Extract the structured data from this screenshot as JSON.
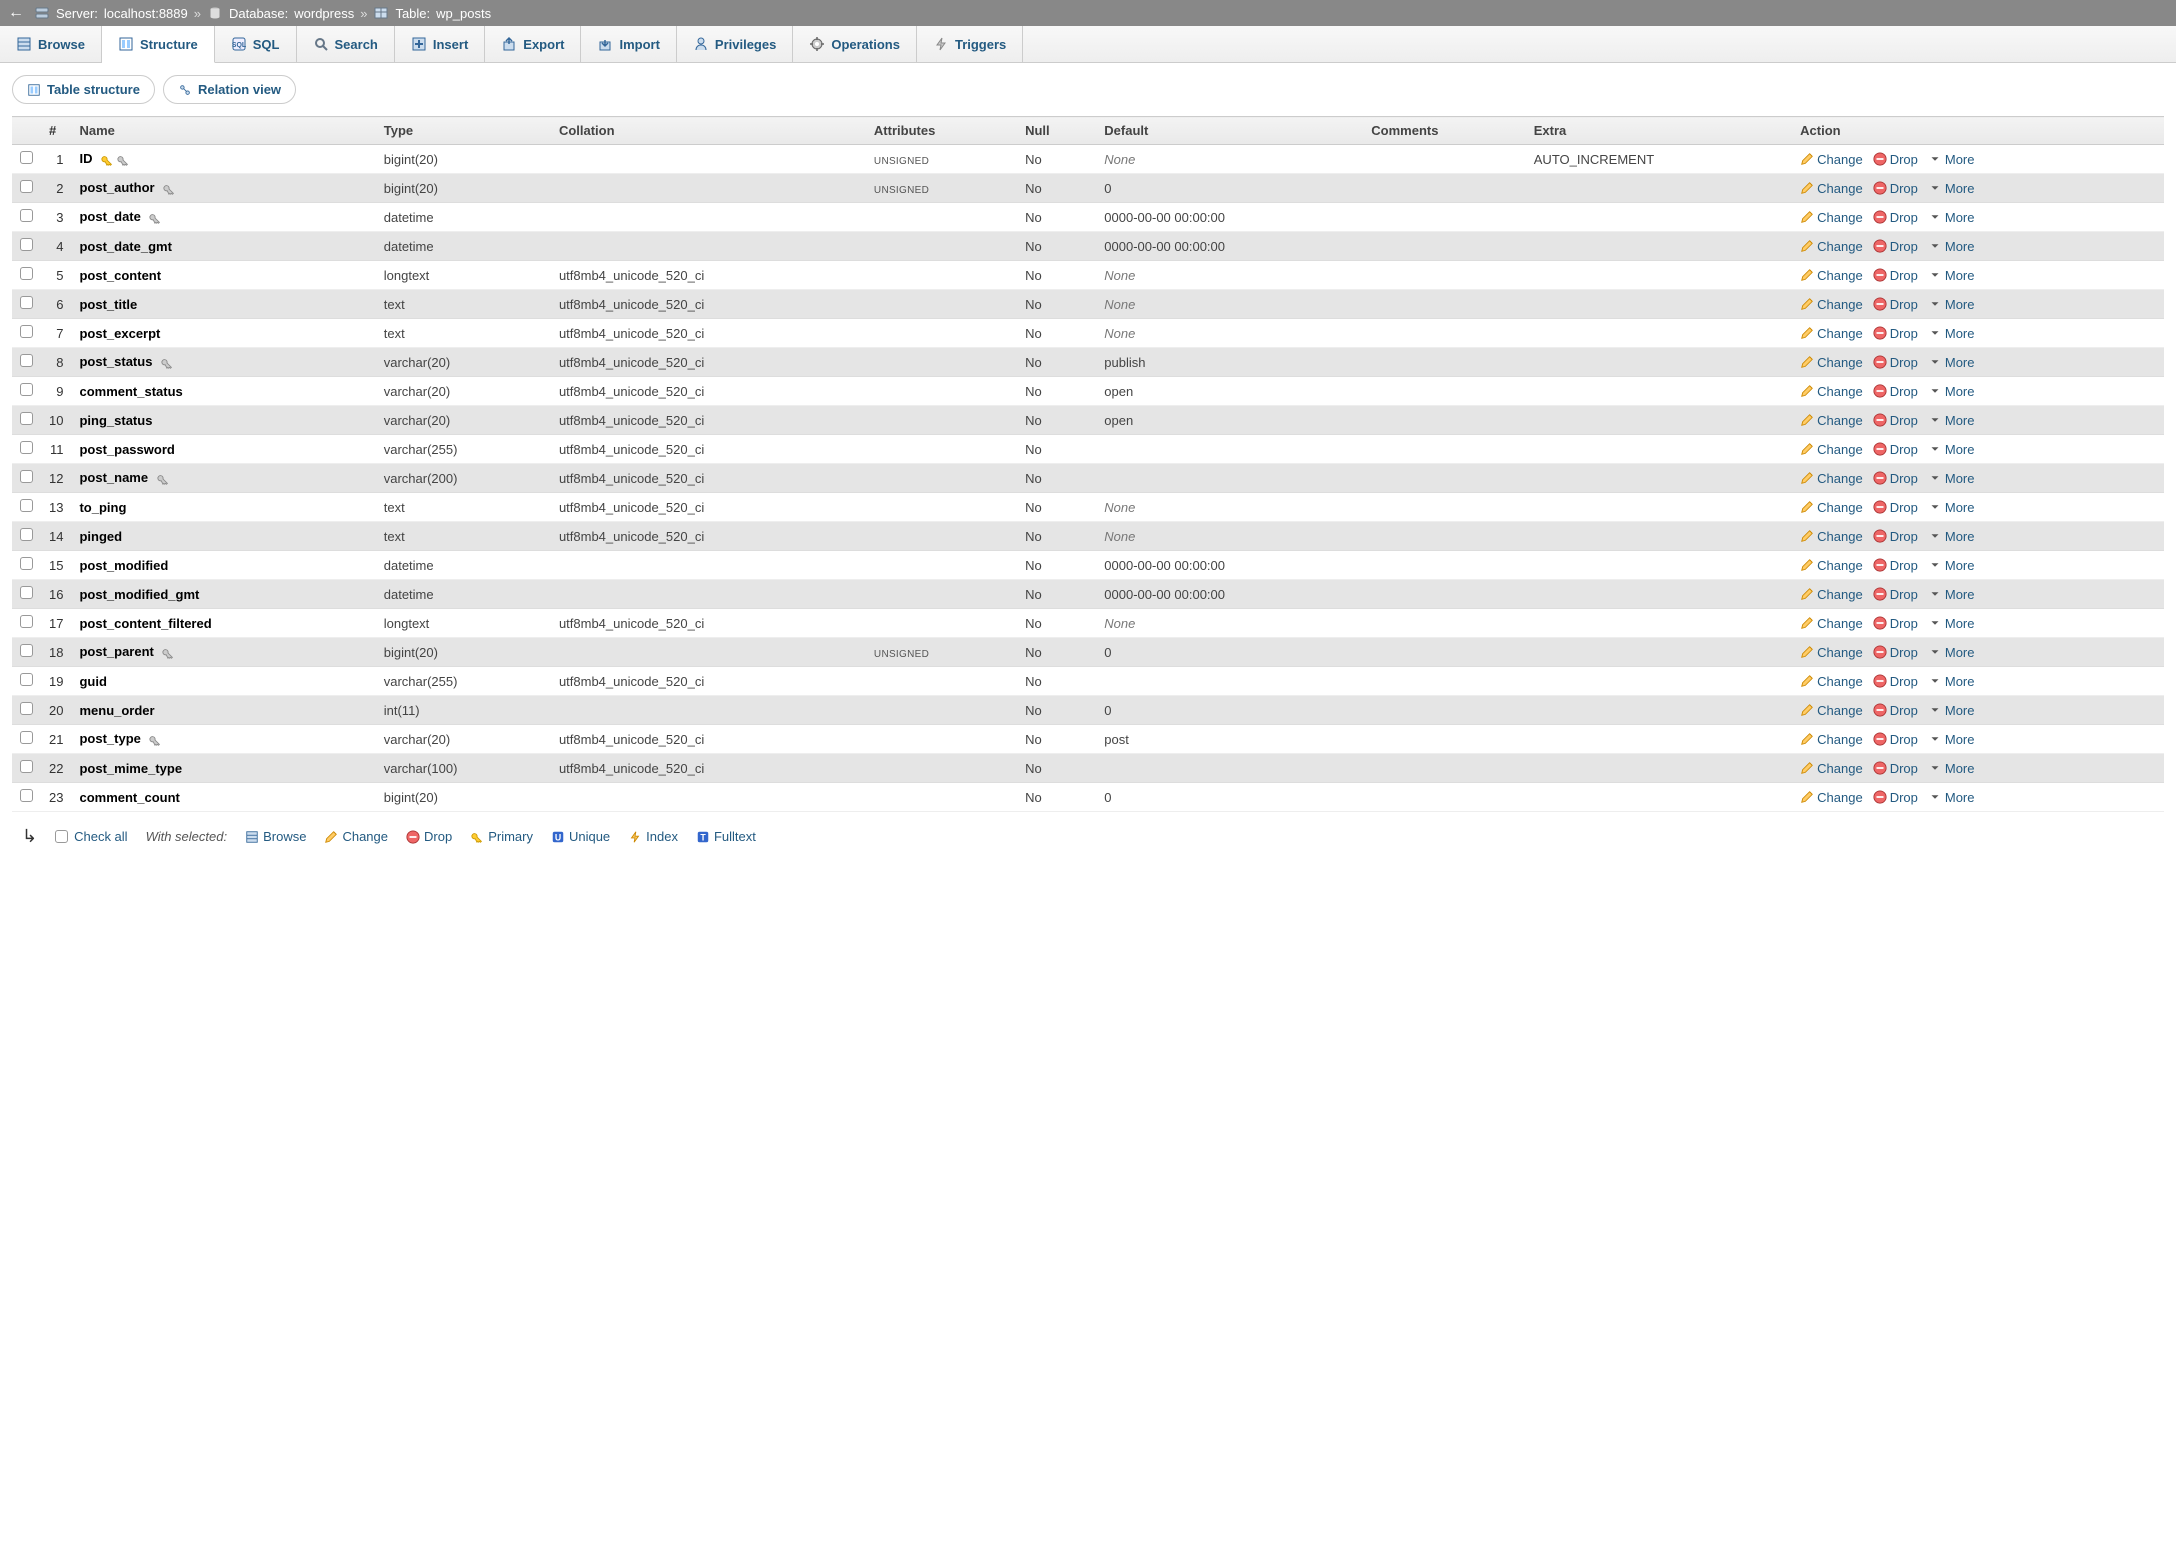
{
  "breadcrumb": {
    "server_label": "Server:",
    "server": "localhost:8889",
    "database_label": "Database:",
    "database": "wordpress",
    "table_label": "Table:",
    "table": "wp_posts"
  },
  "top_tabs": [
    {
      "label": "Browse",
      "icon": "browse-icon"
    },
    {
      "label": "Structure",
      "icon": "structure-icon",
      "active": true
    },
    {
      "label": "SQL",
      "icon": "sql-icon"
    },
    {
      "label": "Search",
      "icon": "search-icon"
    },
    {
      "label": "Insert",
      "icon": "insert-icon"
    },
    {
      "label": "Export",
      "icon": "export-icon"
    },
    {
      "label": "Import",
      "icon": "import-icon"
    },
    {
      "label": "Privileges",
      "icon": "privileges-icon"
    },
    {
      "label": "Operations",
      "icon": "operations-icon"
    },
    {
      "label": "Triggers",
      "icon": "triggers-icon"
    }
  ],
  "sub_tabs": [
    {
      "label": "Table structure",
      "active": true
    },
    {
      "label": "Relation view"
    }
  ],
  "headers": {
    "num": "#",
    "name": "Name",
    "type": "Type",
    "collation": "Collation",
    "attributes": "Attributes",
    "null": "Null",
    "default": "Default",
    "comments": "Comments",
    "extra": "Extra",
    "action": "Action"
  },
  "action_labels": {
    "change": "Change",
    "drop": "Drop",
    "more": "More"
  },
  "columns": [
    {
      "n": "1",
      "name": "ID",
      "type": "bigint(20)",
      "collation": "",
      "attributes": "UNSIGNED",
      "null": "No",
      "default": "None",
      "default_italic": true,
      "comments": "",
      "extra": "AUTO_INCREMENT",
      "primary": true,
      "index": true
    },
    {
      "n": "2",
      "name": "post_author",
      "type": "bigint(20)",
      "collation": "",
      "attributes": "UNSIGNED",
      "null": "No",
      "default": "0",
      "default_italic": false,
      "comments": "",
      "extra": "",
      "primary": false,
      "index": true
    },
    {
      "n": "3",
      "name": "post_date",
      "type": "datetime",
      "collation": "",
      "attributes": "",
      "null": "No",
      "default": "0000-00-00 00:00:00",
      "default_italic": false,
      "comments": "",
      "extra": "",
      "primary": false,
      "index": true
    },
    {
      "n": "4",
      "name": "post_date_gmt",
      "type": "datetime",
      "collation": "",
      "attributes": "",
      "null": "No",
      "default": "0000-00-00 00:00:00",
      "default_italic": false,
      "comments": "",
      "extra": "",
      "primary": false,
      "index": false
    },
    {
      "n": "5",
      "name": "post_content",
      "type": "longtext",
      "collation": "utf8mb4_unicode_520_ci",
      "attributes": "",
      "null": "No",
      "default": "None",
      "default_italic": true,
      "comments": "",
      "extra": "",
      "primary": false,
      "index": false
    },
    {
      "n": "6",
      "name": "post_title",
      "type": "text",
      "collation": "utf8mb4_unicode_520_ci",
      "attributes": "",
      "null": "No",
      "default": "None",
      "default_italic": true,
      "comments": "",
      "extra": "",
      "primary": false,
      "index": false
    },
    {
      "n": "7",
      "name": "post_excerpt",
      "type": "text",
      "collation": "utf8mb4_unicode_520_ci",
      "attributes": "",
      "null": "No",
      "default": "None",
      "default_italic": true,
      "comments": "",
      "extra": "",
      "primary": false,
      "index": false
    },
    {
      "n": "8",
      "name": "post_status",
      "type": "varchar(20)",
      "collation": "utf8mb4_unicode_520_ci",
      "attributes": "",
      "null": "No",
      "default": "publish",
      "default_italic": false,
      "comments": "",
      "extra": "",
      "primary": false,
      "index": true
    },
    {
      "n": "9",
      "name": "comment_status",
      "type": "varchar(20)",
      "collation": "utf8mb4_unicode_520_ci",
      "attributes": "",
      "null": "No",
      "default": "open",
      "default_italic": false,
      "comments": "",
      "extra": "",
      "primary": false,
      "index": false
    },
    {
      "n": "10",
      "name": "ping_status",
      "type": "varchar(20)",
      "collation": "utf8mb4_unicode_520_ci",
      "attributes": "",
      "null": "No",
      "default": "open",
      "default_italic": false,
      "comments": "",
      "extra": "",
      "primary": false,
      "index": false
    },
    {
      "n": "11",
      "name": "post_password",
      "type": "varchar(255)",
      "collation": "utf8mb4_unicode_520_ci",
      "attributes": "",
      "null": "No",
      "default": "",
      "default_italic": false,
      "comments": "",
      "extra": "",
      "primary": false,
      "index": false
    },
    {
      "n": "12",
      "name": "post_name",
      "type": "varchar(200)",
      "collation": "utf8mb4_unicode_520_ci",
      "attributes": "",
      "null": "No",
      "default": "",
      "default_italic": false,
      "comments": "",
      "extra": "",
      "primary": false,
      "index": true
    },
    {
      "n": "13",
      "name": "to_ping",
      "type": "text",
      "collation": "utf8mb4_unicode_520_ci",
      "attributes": "",
      "null": "No",
      "default": "None",
      "default_italic": true,
      "comments": "",
      "extra": "",
      "primary": false,
      "index": false
    },
    {
      "n": "14",
      "name": "pinged",
      "type": "text",
      "collation": "utf8mb4_unicode_520_ci",
      "attributes": "",
      "null": "No",
      "default": "None",
      "default_italic": true,
      "comments": "",
      "extra": "",
      "primary": false,
      "index": false
    },
    {
      "n": "15",
      "name": "post_modified",
      "type": "datetime",
      "collation": "",
      "attributes": "",
      "null": "No",
      "default": "0000-00-00 00:00:00",
      "default_italic": false,
      "comments": "",
      "extra": "",
      "primary": false,
      "index": false
    },
    {
      "n": "16",
      "name": "post_modified_gmt",
      "type": "datetime",
      "collation": "",
      "attributes": "",
      "null": "No",
      "default": "0000-00-00 00:00:00",
      "default_italic": false,
      "comments": "",
      "extra": "",
      "primary": false,
      "index": false
    },
    {
      "n": "17",
      "name": "post_content_filtered",
      "type": "longtext",
      "collation": "utf8mb4_unicode_520_ci",
      "attributes": "",
      "null": "No",
      "default": "None",
      "default_italic": true,
      "comments": "",
      "extra": "",
      "primary": false,
      "index": false
    },
    {
      "n": "18",
      "name": "post_parent",
      "type": "bigint(20)",
      "collation": "",
      "attributes": "UNSIGNED",
      "null": "No",
      "default": "0",
      "default_italic": false,
      "comments": "",
      "extra": "",
      "primary": false,
      "index": true
    },
    {
      "n": "19",
      "name": "guid",
      "type": "varchar(255)",
      "collation": "utf8mb4_unicode_520_ci",
      "attributes": "",
      "null": "No",
      "default": "",
      "default_italic": false,
      "comments": "",
      "extra": "",
      "primary": false,
      "index": false
    },
    {
      "n": "20",
      "name": "menu_order",
      "type": "int(11)",
      "collation": "",
      "attributes": "",
      "null": "No",
      "default": "0",
      "default_italic": false,
      "comments": "",
      "extra": "",
      "primary": false,
      "index": false
    },
    {
      "n": "21",
      "name": "post_type",
      "type": "varchar(20)",
      "collation": "utf8mb4_unicode_520_ci",
      "attributes": "",
      "null": "No",
      "default": "post",
      "default_italic": false,
      "comments": "",
      "extra": "",
      "primary": false,
      "index": true
    },
    {
      "n": "22",
      "name": "post_mime_type",
      "type": "varchar(100)",
      "collation": "utf8mb4_unicode_520_ci",
      "attributes": "",
      "null": "No",
      "default": "",
      "default_italic": false,
      "comments": "",
      "extra": "",
      "primary": false,
      "index": false
    },
    {
      "n": "23",
      "name": "comment_count",
      "type": "bigint(20)",
      "collation": "",
      "attributes": "",
      "null": "No",
      "default": "0",
      "default_italic": false,
      "comments": "",
      "extra": "",
      "primary": false,
      "index": false
    }
  ],
  "footer": {
    "check_all": "Check all",
    "with_selected": "With selected:",
    "actions": [
      {
        "label": "Browse",
        "icon": "browse-icon"
      },
      {
        "label": "Change",
        "icon": "pencil-icon"
      },
      {
        "label": "Drop",
        "icon": "drop-icon"
      },
      {
        "label": "Primary",
        "icon": "primary-icon"
      },
      {
        "label": "Unique",
        "icon": "unique-icon"
      },
      {
        "label": "Index",
        "icon": "index-icon"
      },
      {
        "label": "Fulltext",
        "icon": "fulltext-icon"
      }
    ]
  }
}
